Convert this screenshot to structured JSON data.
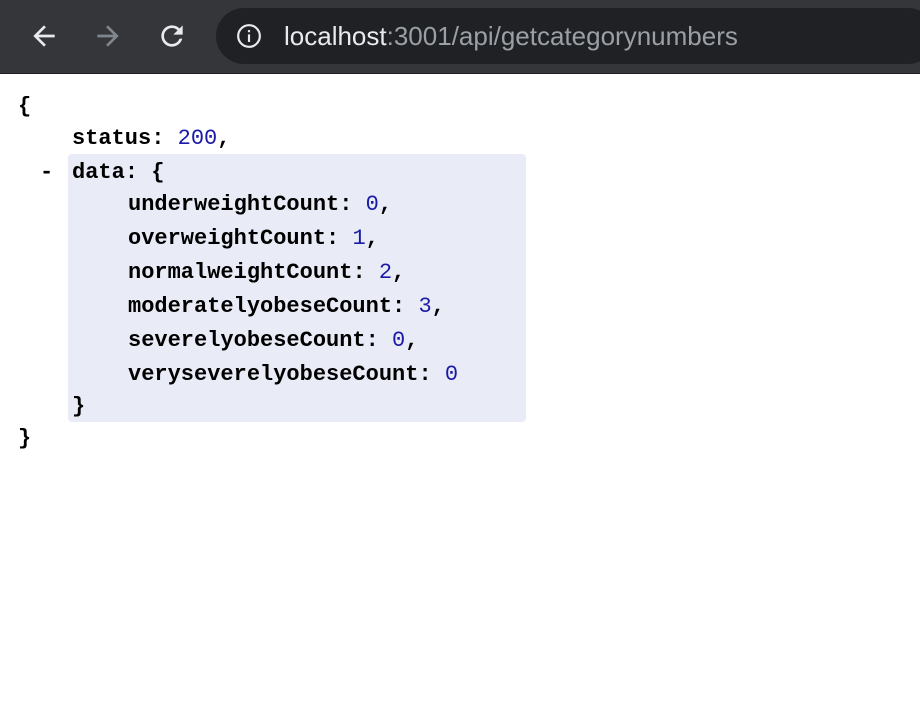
{
  "browser": {
    "url_host": "localhost",
    "url_rest": ":3001/api/getcategorynumbers",
    "icons": {
      "back": "arrow-left-icon",
      "forward": "arrow-right-icon",
      "reload": "reload-icon",
      "info": "info-icon"
    }
  },
  "json_view": {
    "open_brace": "{",
    "close_brace": "}",
    "collapse_symbol": "-",
    "status_key": "status",
    "status_value": "200",
    "data_key": "data",
    "data_open": "{",
    "data_close": "}",
    "colon": ":",
    "comma": ",",
    "fields": [
      {
        "key": "underweightCount",
        "value": "0"
      },
      {
        "key": "overweightCount",
        "value": "1"
      },
      {
        "key": "normalweightCount",
        "value": "2"
      },
      {
        "key": "moderatelyobeseCount",
        "value": "3"
      },
      {
        "key": "severelyobeseCount",
        "value": "0"
      },
      {
        "key": "veryseverelyobeseCount",
        "value": "0"
      }
    ]
  },
  "colors": {
    "toolbar_bg": "#35363a",
    "omnibox_bg": "#202124",
    "number": "#1a1aa6",
    "highlight": "#e9ecf6"
  }
}
